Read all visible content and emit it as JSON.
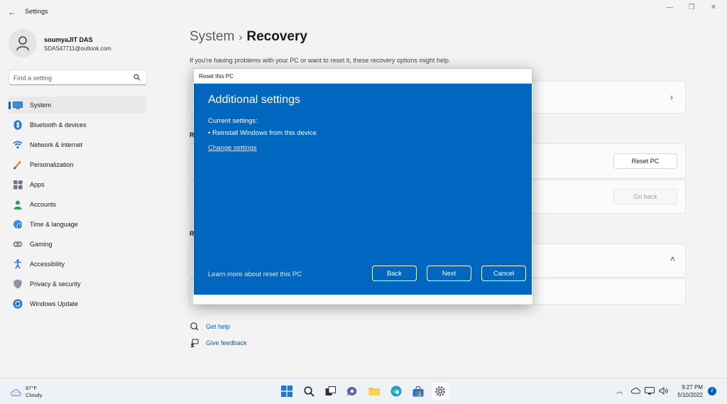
{
  "window": {
    "app_title": "Settings",
    "back_glyph": "←",
    "minimize_glyph": "—",
    "maximize_glyph": "❐",
    "close_glyph": "✕"
  },
  "profile": {
    "name": "soumyaJIT DAS",
    "email": "SDAS47711@outlook.com"
  },
  "search": {
    "placeholder": "Find a setting"
  },
  "nav": [
    {
      "label": "System",
      "icon": "system-icon",
      "active": true
    },
    {
      "label": "Bluetooth & devices",
      "icon": "bluetooth-icon"
    },
    {
      "label": "Network & internet",
      "icon": "network-icon"
    },
    {
      "label": "Personalization",
      "icon": "personalization-icon"
    },
    {
      "label": "Apps",
      "icon": "apps-icon"
    },
    {
      "label": "Accounts",
      "icon": "accounts-icon"
    },
    {
      "label": "Time & language",
      "icon": "time-language-icon"
    },
    {
      "label": "Gaming",
      "icon": "gaming-icon"
    },
    {
      "label": "Accessibility",
      "icon": "accessibility-icon"
    },
    {
      "label": "Privacy & security",
      "icon": "privacy-icon"
    },
    {
      "label": "Windows Update",
      "icon": "windows-update-icon"
    }
  ],
  "main": {
    "breadcrumb_parent": "System",
    "breadcrumb_separator": "›",
    "breadcrumb_current": "Recovery",
    "intro": "If you're having problems with your PC or want to reset it, these recovery options might help.",
    "section_letter_1": "R",
    "section_letter_2": "R",
    "reset_pc_label": "Reset PC",
    "go_back_label": "Go back",
    "help_links": {
      "get_help": "Get help",
      "give_feedback": "Give feedback"
    }
  },
  "dialog": {
    "title": "Reset this PC",
    "heading": "Additional settings",
    "current_label": "Current settings:",
    "bullet": "Reinstall Windows from this device",
    "change_link": "Change settings",
    "learn_link": "Learn more about reset this PC",
    "back_label": "Back",
    "next_label": "Next",
    "cancel_label": "Cancel"
  },
  "taskbar": {
    "weather_temp": "87°F",
    "weather_desc": "Cloudy",
    "time": "9:27 PM",
    "date": "5/10/2022",
    "notification_count": "2"
  },
  "colors": {
    "accent": "#005fb8",
    "dialog_bg": "#0067c0"
  }
}
